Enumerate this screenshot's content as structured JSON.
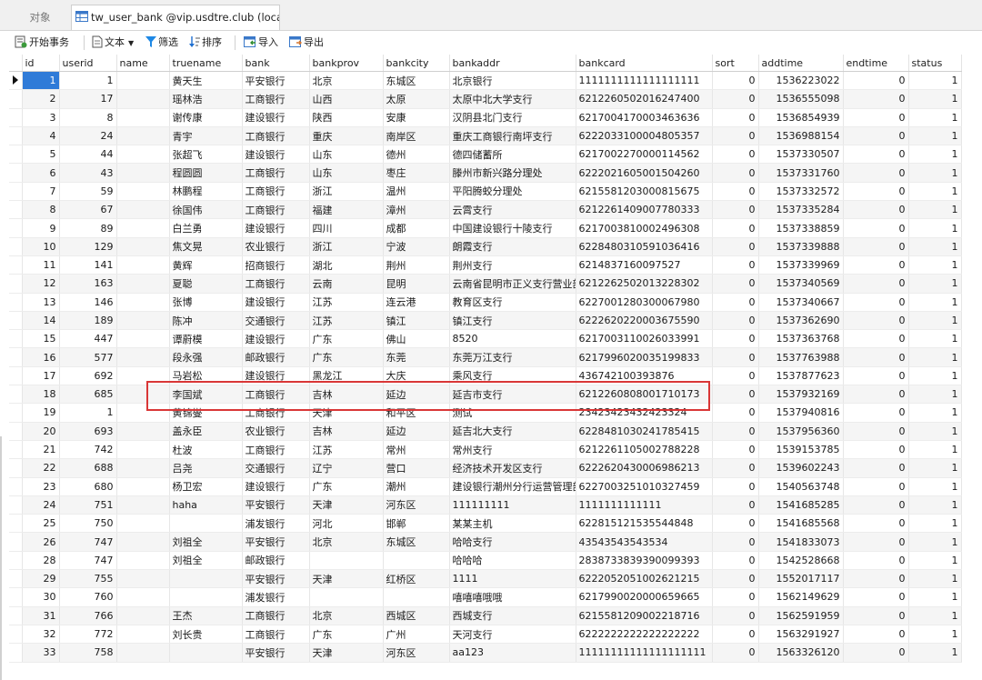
{
  "tabs": {
    "object_label": "对象",
    "active_label": "tw_user_bank @vip.usdtre.club (local..."
  },
  "toolbar": {
    "begin_tx": "开始事务",
    "text": "文本",
    "filter": "筛选",
    "sort": "排序",
    "import": "导入",
    "export": "导出"
  },
  "columns": [
    "id",
    "userid",
    "name",
    "truename",
    "bank",
    "bankprov",
    "bankcity",
    "bankaddr",
    "bankcard",
    "sort",
    "addtime",
    "endtime",
    "status"
  ],
  "rows": [
    {
      "id": "1",
      "userid": "1",
      "name": "",
      "truename": "黄天生",
      "bank": "平安银行",
      "bankprov": "北京",
      "bankcity": "东城区",
      "bankaddr": "北京银行",
      "bankcard": "1111111111111111111",
      "sort": "0",
      "addtime": "1536223022",
      "endtime": "0",
      "status": "1"
    },
    {
      "id": "2",
      "userid": "17",
      "name": "",
      "truename": "瑶林浩",
      "bank": "工商银行",
      "bankprov": "山西",
      "bankcity": "太原",
      "bankaddr": "太原中北大学支行",
      "bankcard": "6212260502016247400",
      "sort": "0",
      "addtime": "1536555098",
      "endtime": "0",
      "status": "1"
    },
    {
      "id": "3",
      "userid": "8",
      "name": "",
      "truename": "谢传康",
      "bank": "建设银行",
      "bankprov": "陕西",
      "bankcity": "安康",
      "bankaddr": "汉阴县北门支行",
      "bankcard": "6217004170003463636",
      "sort": "0",
      "addtime": "1536854939",
      "endtime": "0",
      "status": "1"
    },
    {
      "id": "4",
      "userid": "24",
      "name": "",
      "truename": "青宇",
      "bank": "工商银行",
      "bankprov": "重庆",
      "bankcity": "南岸区",
      "bankaddr": "重庆工商银行南坪支行",
      "bankcard": "6222033100004805357",
      "sort": "0",
      "addtime": "1536988154",
      "endtime": "0",
      "status": "1"
    },
    {
      "id": "5",
      "userid": "44",
      "name": "",
      "truename": "张超飞",
      "bank": "建设银行",
      "bankprov": "山东",
      "bankcity": "德州",
      "bankaddr": "德四储蓄所",
      "bankcard": "6217002270000114562",
      "sort": "0",
      "addtime": "1537330507",
      "endtime": "0",
      "status": "1"
    },
    {
      "id": "6",
      "userid": "43",
      "name": "",
      "truename": "程圆圆",
      "bank": "工商银行",
      "bankprov": "山东",
      "bankcity": "枣庄",
      "bankaddr": "滕州市新兴路分理处",
      "bankcard": "6222021605001504260",
      "sort": "0",
      "addtime": "1537331760",
      "endtime": "0",
      "status": "1"
    },
    {
      "id": "7",
      "userid": "59",
      "name": "",
      "truename": "林鹏程",
      "bank": "工商银行",
      "bankprov": "浙江",
      "bankcity": "温州",
      "bankaddr": "平阳腾蛟分理处",
      "bankcard": "6215581203000815675",
      "sort": "0",
      "addtime": "1537332572",
      "endtime": "0",
      "status": "1"
    },
    {
      "id": "8",
      "userid": "67",
      "name": "",
      "truename": "徐国伟",
      "bank": "工商银行",
      "bankprov": "福建",
      "bankcity": "漳州",
      "bankaddr": "云霄支行",
      "bankcard": "6212261409007780333",
      "sort": "0",
      "addtime": "1537335284",
      "endtime": "0",
      "status": "1"
    },
    {
      "id": "9",
      "userid": "89",
      "name": "",
      "truename": "白兰勇",
      "bank": "建设银行",
      "bankprov": "四川",
      "bankcity": "成都",
      "bankaddr": "中国建设银行十陵支行",
      "bankcard": "6217003810002496308",
      "sort": "0",
      "addtime": "1537338859",
      "endtime": "0",
      "status": "1"
    },
    {
      "id": "10",
      "userid": "129",
      "name": "",
      "truename": "焦文晃",
      "bank": "农业银行",
      "bankprov": "浙江",
      "bankcity": "宁波",
      "bankaddr": "朗霞支行",
      "bankcard": "6228480310591036416",
      "sort": "0",
      "addtime": "1537339888",
      "endtime": "0",
      "status": "1"
    },
    {
      "id": "11",
      "userid": "141",
      "name": "",
      "truename": "黄辉",
      "bank": "招商银行",
      "bankprov": "湖北",
      "bankcity": "荆州",
      "bankaddr": "荆州支行",
      "bankcard": "6214837160097527",
      "sort": "0",
      "addtime": "1537339969",
      "endtime": "0",
      "status": "1"
    },
    {
      "id": "12",
      "userid": "163",
      "name": "",
      "truename": "夏聪",
      "bank": "工商银行",
      "bankprov": "云南",
      "bankcity": "昆明",
      "bankaddr": "云南省昆明市正义支行营业部",
      "bankcard": "6212262502013228302",
      "sort": "0",
      "addtime": "1537340569",
      "endtime": "0",
      "status": "1"
    },
    {
      "id": "13",
      "userid": "146",
      "name": "",
      "truename": "张博",
      "bank": "建设银行",
      "bankprov": "江苏",
      "bankcity": "连云港",
      "bankaddr": "教育区支行",
      "bankcard": "6227001280300067980",
      "sort": "0",
      "addtime": "1537340667",
      "endtime": "0",
      "status": "1"
    },
    {
      "id": "14",
      "userid": "189",
      "name": "",
      "truename": "陈冲",
      "bank": "交通银行",
      "bankprov": "江苏",
      "bankcity": "镇江",
      "bankaddr": "镇江支行",
      "bankcard": "6222620220003675590",
      "sort": "0",
      "addtime": "1537362690",
      "endtime": "0",
      "status": "1"
    },
    {
      "id": "15",
      "userid": "447",
      "name": "",
      "truename": "谭蔚模",
      "bank": "建设银行",
      "bankprov": "广东",
      "bankcity": "佛山",
      "bankaddr": "8520",
      "bankcard": "6217003110026033991",
      "sort": "0",
      "addtime": "1537363768",
      "endtime": "0",
      "status": "1"
    },
    {
      "id": "16",
      "userid": "577",
      "name": "",
      "truename": "段永强",
      "bank": "邮政银行",
      "bankprov": "广东",
      "bankcity": "东莞",
      "bankaddr": "东莞万江支行",
      "bankcard": "6217996020035199833",
      "sort": "0",
      "addtime": "1537763988",
      "endtime": "0",
      "status": "1"
    },
    {
      "id": "17",
      "userid": "692",
      "name": "",
      "truename": "马岩松",
      "bank": "建设银行",
      "bankprov": "黑龙江",
      "bankcity": "大庆",
      "bankaddr": "乘风支行",
      "bankcard": "436742100393876",
      "sort": "0",
      "addtime": "1537877623",
      "endtime": "0",
      "status": "1"
    },
    {
      "id": "18",
      "userid": "685",
      "name": "",
      "truename": "李国斌",
      "bank": "工商银行",
      "bankprov": "吉林",
      "bankcity": "延边",
      "bankaddr": "延吉市支行",
      "bankcard": "6212260808001710173",
      "sort": "0",
      "addtime": "1537932169",
      "endtime": "0",
      "status": "1"
    },
    {
      "id": "19",
      "userid": "1",
      "name": "",
      "truename": "黄锦燮",
      "bank": "工商银行",
      "bankprov": "天津",
      "bankcity": "和平区",
      "bankaddr": "测试",
      "bankcard": "23423423432423324",
      "sort": "0",
      "addtime": "1537940816",
      "endtime": "0",
      "status": "1"
    },
    {
      "id": "20",
      "userid": "693",
      "name": "",
      "truename": "盖永臣",
      "bank": "农业银行",
      "bankprov": "吉林",
      "bankcity": "延边",
      "bankaddr": "延吉北大支行",
      "bankcard": "6228481030241785415",
      "sort": "0",
      "addtime": "1537956360",
      "endtime": "0",
      "status": "1"
    },
    {
      "id": "21",
      "userid": "742",
      "name": "",
      "truename": "杜波",
      "bank": "工商银行",
      "bankprov": "江苏",
      "bankcity": "常州",
      "bankaddr": "常州支行",
      "bankcard": "6212261105002788228",
      "sort": "0",
      "addtime": "1539153785",
      "endtime": "0",
      "status": "1"
    },
    {
      "id": "22",
      "userid": "688",
      "name": "",
      "truename": "吕尧",
      "bank": "交通银行",
      "bankprov": "辽宁",
      "bankcity": "营口",
      "bankaddr": "经济技术开发区支行",
      "bankcard": "6222620430006986213",
      "sort": "0",
      "addtime": "1539602243",
      "endtime": "0",
      "status": "1"
    },
    {
      "id": "23",
      "userid": "680",
      "name": "",
      "truename": "杨卫宏",
      "bank": "建设银行",
      "bankprov": "广东",
      "bankcity": "潮州",
      "bankaddr": "建设银行潮州分行运营管理部",
      "bankcard": "6227003251010327459",
      "sort": "0",
      "addtime": "1540563748",
      "endtime": "0",
      "status": "1"
    },
    {
      "id": "24",
      "userid": "751",
      "name": "",
      "truename": "haha",
      "bank": "平安银行",
      "bankprov": "天津",
      "bankcity": "河东区",
      "bankaddr": "111111111",
      "bankcard": "1111111111111",
      "sort": "0",
      "addtime": "1541685285",
      "endtime": "0",
      "status": "1"
    },
    {
      "id": "25",
      "userid": "750",
      "name": "",
      "truename": "",
      "bank": "浦发银行",
      "bankprov": "河北",
      "bankcity": "邯郸",
      "bankaddr": "某某主机",
      "bankcard": "622815121535544848",
      "sort": "0",
      "addtime": "1541685568",
      "endtime": "0",
      "status": "1"
    },
    {
      "id": "26",
      "userid": "747",
      "name": "",
      "truename": "刘祖全",
      "bank": "平安银行",
      "bankprov": "北京",
      "bankcity": "东城区",
      "bankaddr": "哈哈支行",
      "bankcard": "43543543543534",
      "sort": "0",
      "addtime": "1541833073",
      "endtime": "0",
      "status": "1"
    },
    {
      "id": "28",
      "userid": "747",
      "name": "",
      "truename": "刘祖全",
      "bank": "邮政银行",
      "bankprov": "",
      "bankcity": "",
      "bankaddr": "哈哈哈",
      "bankcard": "2838733839390099393",
      "sort": "0",
      "addtime": "1542528668",
      "endtime": "0",
      "status": "1"
    },
    {
      "id": "29",
      "userid": "755",
      "name": "",
      "truename": "",
      "bank": "平安银行",
      "bankprov": "天津",
      "bankcity": "红桥区",
      "bankaddr": "1111",
      "bankcard": "6222052051002621215",
      "sort": "0",
      "addtime": "1552017117",
      "endtime": "0",
      "status": "1"
    },
    {
      "id": "30",
      "userid": "760",
      "name": "",
      "truename": "",
      "bank": "浦发银行",
      "bankprov": "",
      "bankcity": "",
      "bankaddr": "嘻嘻嘻哦哦",
      "bankcard": "6217990020000659665",
      "sort": "0",
      "addtime": "1562149629",
      "endtime": "0",
      "status": "1"
    },
    {
      "id": "31",
      "userid": "766",
      "name": "",
      "truename": "王杰",
      "bank": "工商银行",
      "bankprov": "北京",
      "bankcity": "西城区",
      "bankaddr": "西城支行",
      "bankcard": "6215581209002218716",
      "sort": "0",
      "addtime": "1562591959",
      "endtime": "0",
      "status": "1"
    },
    {
      "id": "32",
      "userid": "772",
      "name": "",
      "truename": "刘长贵",
      "bank": "工商银行",
      "bankprov": "广东",
      "bankcity": "广州",
      "bankaddr": "天河支行",
      "bankcard": "6222222222222222222",
      "sort": "0",
      "addtime": "1563291927",
      "endtime": "0",
      "status": "1"
    },
    {
      "id": "33",
      "userid": "758",
      "name": "",
      "truename": "",
      "bank": "平安银行",
      "bankprov": "天津",
      "bankcity": "河东区",
      "bankaddr": "aa123",
      "bankcard": "11111111111111111111",
      "sort": "0",
      "addtime": "1563326120",
      "endtime": "0",
      "status": "1"
    }
  ],
  "colors": {
    "selection": "#2f7bd8",
    "highlight_box": "#d93636",
    "filter_icon": "#1e88e5"
  }
}
